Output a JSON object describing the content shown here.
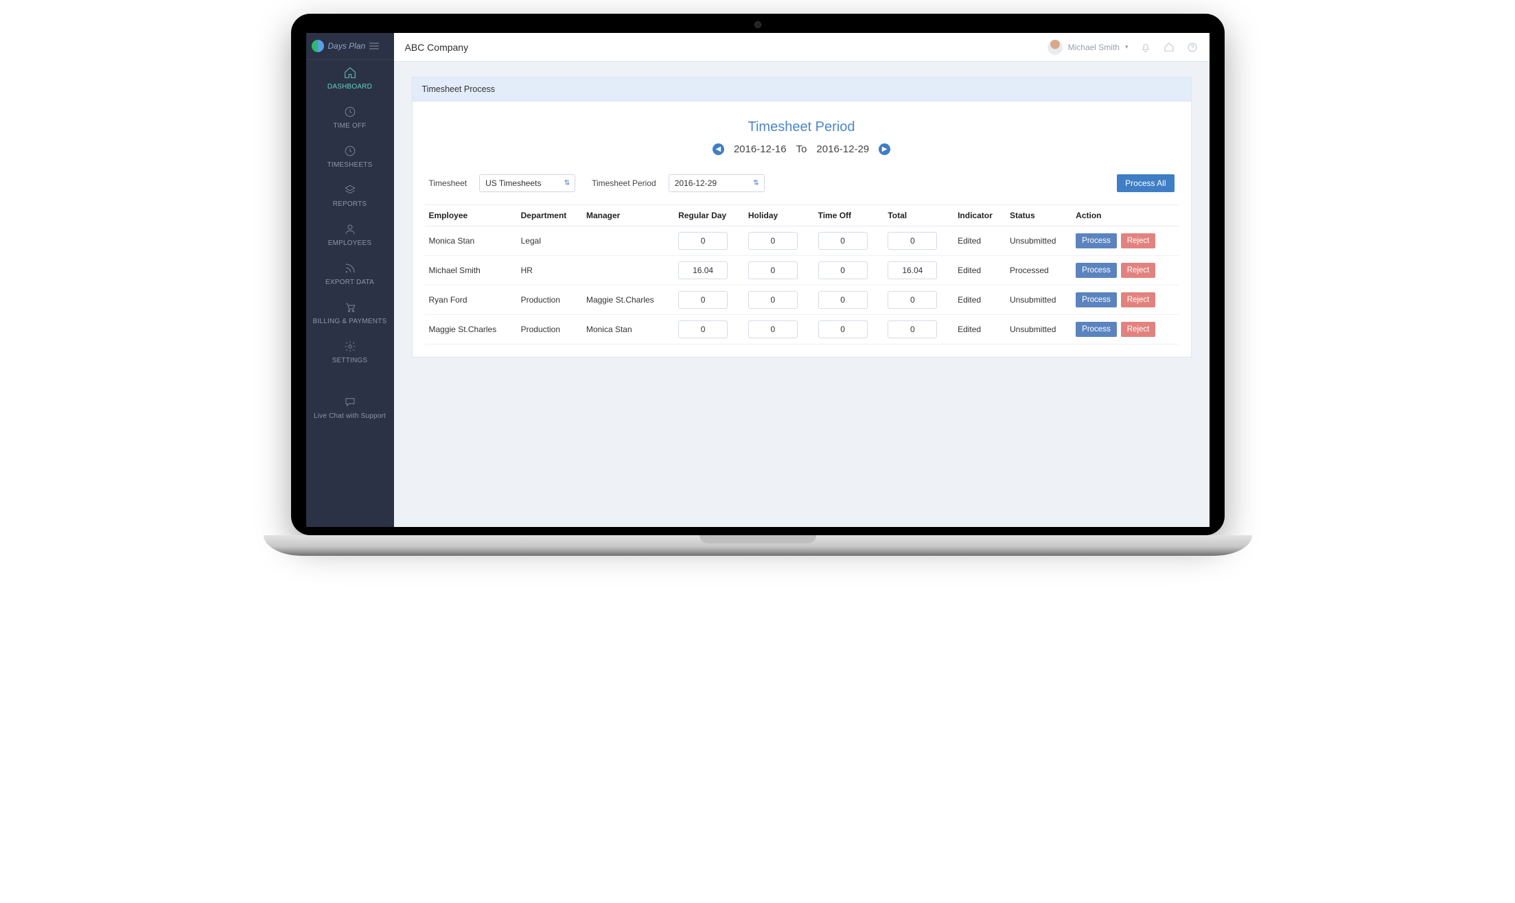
{
  "brand": {
    "name": "Days Plan"
  },
  "company": "ABC Company",
  "user": {
    "name": "Michael Smith"
  },
  "sidebar": {
    "items": [
      {
        "label": "DASHBOARD"
      },
      {
        "label": "TIME OFF"
      },
      {
        "label": "TIMESHEETS"
      },
      {
        "label": "REPORTS"
      },
      {
        "label": "EMPLOYEES"
      },
      {
        "label": "EXPORT DATA"
      },
      {
        "label": "BILLING & PAYMENTS"
      },
      {
        "label": "SETTINGS"
      }
    ],
    "chat_label": "Live Chat with Support"
  },
  "panel": {
    "title": "Timesheet Process",
    "period_title": "Timesheet Period",
    "range_from": "2016-12-16",
    "range_to_label": "To",
    "range_to": "2016-12-29"
  },
  "filters": {
    "timesheet_label": "Timesheet",
    "timesheet_value": "US Timesheets",
    "period_label": "Timesheet Period",
    "period_value": "2016-12-29",
    "process_all_label": "Process All"
  },
  "table": {
    "headers": {
      "employee": "Employee",
      "department": "Department",
      "manager": "Manager",
      "regular": "Regular Day",
      "holiday": "Holiday",
      "timeoff": "Time Off",
      "total": "Total",
      "indicator": "Indicator",
      "status": "Status",
      "action": "Action"
    },
    "process_label": "Process",
    "reject_label": "Reject",
    "rows": [
      {
        "employee": "Monica Stan",
        "department": "Legal",
        "manager": "",
        "regular": "0",
        "holiday": "0",
        "timeoff": "0",
        "total": "0",
        "indicator": "Edited",
        "status": "Unsubmitted"
      },
      {
        "employee": "Michael Smith",
        "department": "HR",
        "manager": "",
        "regular": "16.04",
        "holiday": "0",
        "timeoff": "0",
        "total": "16.04",
        "indicator": "Edited",
        "status": "Processed"
      },
      {
        "employee": "Ryan Ford",
        "department": "Production",
        "manager": "Maggie St.Charles",
        "regular": "0",
        "holiday": "0",
        "timeoff": "0",
        "total": "0",
        "indicator": "Edited",
        "status": "Unsubmitted"
      },
      {
        "employee": "Maggie St.Charles",
        "department": "Production",
        "manager": "Monica Stan",
        "regular": "0",
        "holiday": "0",
        "timeoff": "0",
        "total": "0",
        "indicator": "Edited",
        "status": "Unsubmitted"
      }
    ]
  }
}
